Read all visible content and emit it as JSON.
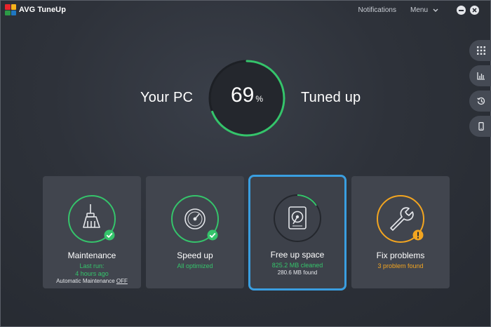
{
  "app": {
    "brand": "AVG",
    "product": "TuneUp"
  },
  "topnav": {
    "notifications": "Notifications",
    "menu": "Menu"
  },
  "hero": {
    "left_label": "Your PC",
    "value": "69",
    "unit": "%",
    "right_label": "Tuned up",
    "progress_fraction": 0.69
  },
  "rail": [
    "grid-icon",
    "bar-chart-icon",
    "history-icon",
    "phone-icon"
  ],
  "cards": [
    {
      "title": "Maintenance",
      "line1": "Last run:",
      "line2": "4 hours ago",
      "line3_prefix": "Automatic Maintenance ",
      "line3_link": "OFF",
      "icon": "broom-icon",
      "badge": "check-badge"
    },
    {
      "title": "Speed up",
      "line1": "All optimized",
      "icon": "speedometer-icon",
      "badge": "check-badge"
    },
    {
      "title": "Free up space",
      "line1": "825.2 MB cleaned",
      "line2": "280.6 MB found",
      "icon": "hard-drive-icon"
    },
    {
      "title": "Fix problems",
      "line1": "3 problem found",
      "icon": "wrench-icon",
      "badge": "warning-badge"
    }
  ],
  "colors": {
    "green": "#35c46b",
    "orange": "#f3a520",
    "selected_border": "#3a9ee0",
    "logo": [
      "#e8242b",
      "#f7b21b",
      "#2d9a46",
      "#1f77c1"
    ]
  }
}
